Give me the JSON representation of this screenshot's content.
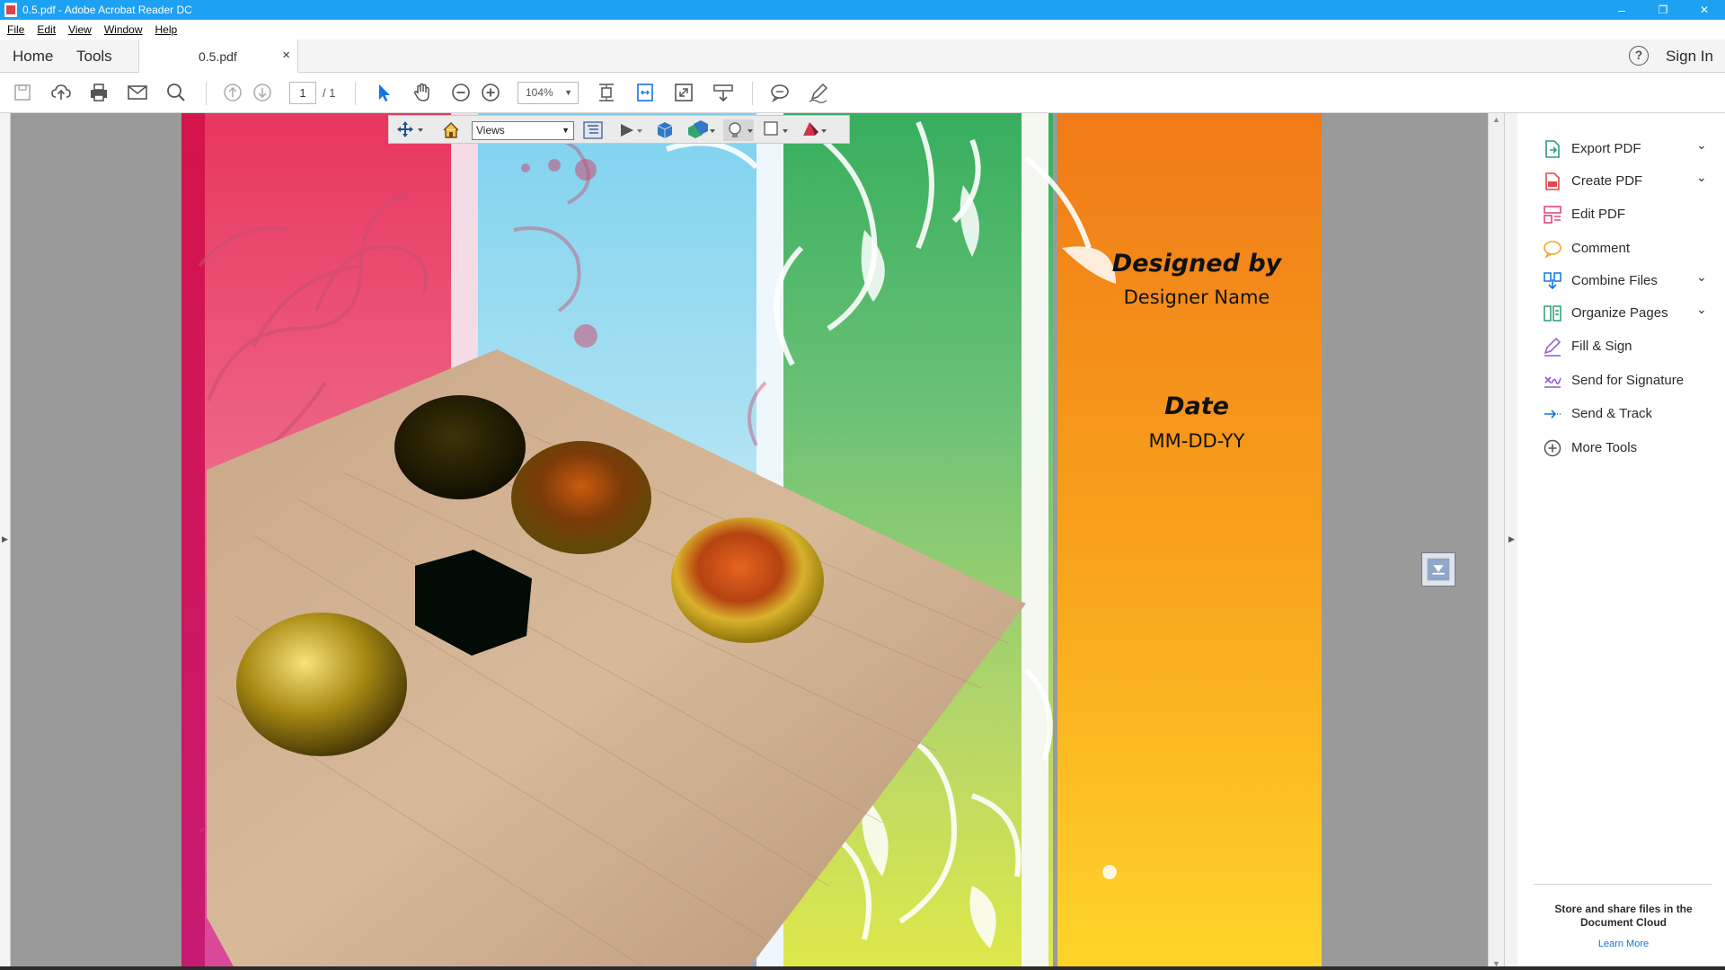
{
  "window": {
    "title": "0.5.pdf - Adobe Acrobat Reader DC",
    "minimize": "–",
    "restore": "❐",
    "close": "✕"
  },
  "menu": [
    "File",
    "Edit",
    "View",
    "Window",
    "Help"
  ],
  "tabs": {
    "home": "Home",
    "tools": "Tools",
    "document": "0.5.pdf",
    "close": "×"
  },
  "header": {
    "help": "?",
    "sign_in": "Sign In"
  },
  "toolbar": {
    "page_current": "1",
    "page_total": "/ 1",
    "zoom": "104%"
  },
  "toolbar_3d": {
    "views": "Views"
  },
  "document": {
    "designed_by": "Designed by",
    "designer_name": "Designer Name",
    "date_label": "Date",
    "date_value": "MM-DD-YY"
  },
  "right_panel": {
    "items": [
      {
        "label": "Export PDF",
        "icon": "export-pdf-icon",
        "color": "#2d9d78",
        "expandable": true
      },
      {
        "label": "Create PDF",
        "icon": "create-pdf-icon",
        "color": "#e34850",
        "expandable": true
      },
      {
        "label": "Edit PDF",
        "icon": "edit-pdf-icon",
        "color": "#e34882",
        "expandable": false
      },
      {
        "label": "Comment",
        "icon": "comment-icon",
        "color": "#f5a623",
        "expandable": false
      },
      {
        "label": "Combine Files",
        "icon": "combine-files-icon",
        "color": "#1473e6",
        "expandable": true
      },
      {
        "label": "Organize Pages",
        "icon": "organize-pages-icon",
        "color": "#2d9d78",
        "expandable": true
      },
      {
        "label": "Fill & Sign",
        "icon": "fill-sign-icon",
        "color": "#9256d9",
        "expandable": false
      },
      {
        "label": "Send for Signature",
        "icon": "send-signature-icon",
        "color": "#9256d9",
        "expandable": false
      },
      {
        "label": "Send & Track",
        "icon": "send-track-icon",
        "color": "#1473e6",
        "expandable": false
      },
      {
        "label": "More Tools",
        "icon": "more-tools-icon",
        "color": "#555555",
        "expandable": false
      }
    ],
    "store_text": "Store and share files in the Document Cloud",
    "learn_more": "Learn More"
  }
}
